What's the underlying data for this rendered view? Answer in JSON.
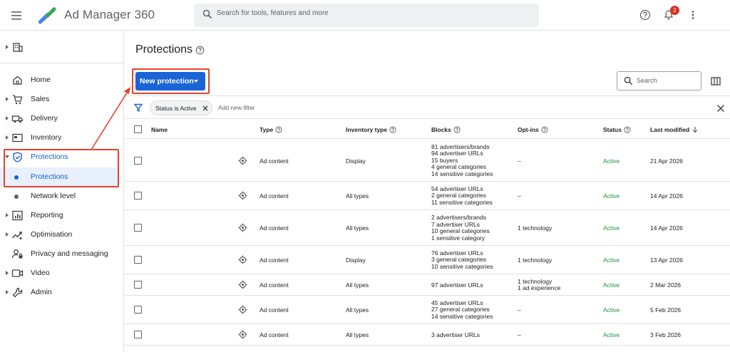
{
  "app": {
    "title": "Ad Manager 360"
  },
  "search": {
    "placeholder": "Search for tools, features and more"
  },
  "notifications": {
    "count": "2"
  },
  "sidebar": {
    "items": [
      {
        "label": "Home",
        "icon": "home-icon"
      },
      {
        "label": "Sales",
        "icon": "cart-icon"
      },
      {
        "label": "Delivery",
        "icon": "truck-icon"
      },
      {
        "label": "Inventory",
        "icon": "inventory-icon"
      },
      {
        "label": "Protections",
        "icon": "shield-icon"
      },
      {
        "label": "Protections",
        "icon": "dot"
      },
      {
        "label": "Network level",
        "icon": "dot"
      },
      {
        "label": "Reporting",
        "icon": "reporting-icon"
      },
      {
        "label": "Optimisation",
        "icon": "optimisation-icon"
      },
      {
        "label": "Privacy and messaging",
        "icon": "privacy-icon"
      },
      {
        "label": "Video",
        "icon": "video-icon"
      },
      {
        "label": "Admin",
        "icon": "wrench-icon"
      }
    ]
  },
  "page": {
    "title": "Protections",
    "new_button_label": "New protection",
    "table_search_placeholder": "Search"
  },
  "filters": {
    "chip_label": "Status is Active",
    "add_filter_label": "Add new filter"
  },
  "table": {
    "columns": [
      "Name",
      "Type",
      "Inventory type",
      "Blocks",
      "Opt-ins",
      "Status",
      "Last modified"
    ],
    "sort_column": "Last modified",
    "sort_direction": "descending",
    "rows": [
      {
        "type": "Ad content",
        "inventory_type": "Display",
        "blocks": "81 advertisers/brands\n94 advertiser URLs\n15 buyers\n4 general categories\n14 sensitive categories",
        "opt_ins": "–",
        "status": "Active",
        "last_modified": "21 Apr 2026"
      },
      {
        "type": "Ad content",
        "inventory_type": "All types",
        "blocks": "54 advertiser URLs\n2 general categories\n11 sensitive categories",
        "opt_ins": "–",
        "status": "Active",
        "last_modified": "14 Apr 2026"
      },
      {
        "type": "Ad content",
        "inventory_type": "All types",
        "blocks": "2 advertisers/brands\n7 advertiser URLs\n10 general categories\n1 sensitive category",
        "opt_ins": "1 technology",
        "status": "Active",
        "last_modified": "14 Apr 2026"
      },
      {
        "type": "Ad content",
        "inventory_type": "Display",
        "blocks": "76 advertiser URLs\n3 general categories\n10 sensitive categories",
        "opt_ins": "1 technology",
        "status": "Active",
        "last_modified": "13 Apr 2026"
      },
      {
        "type": "Ad content",
        "inventory_type": "All types",
        "blocks": "97 advertiser URLs",
        "opt_ins": "1 technology\n1 ad experience",
        "status": "Active",
        "last_modified": "2 Mar 2026"
      },
      {
        "type": "Ad content",
        "inventory_type": "All types",
        "blocks": "45 advertiser URLs\n27 general categories\n14 sensitive categories",
        "opt_ins": "–",
        "status": "Active",
        "last_modified": "5 Feb 2026"
      },
      {
        "type": "Ad content",
        "inventory_type": "All types",
        "blocks": "3 advertiser URLs",
        "opt_ins": "–",
        "status": "Active",
        "last_modified": "3 Feb 2026"
      }
    ]
  },
  "colors": {
    "accent": "#1a64d8",
    "active_status": "#1e8e3e",
    "annotation": "#e8412c",
    "selected_bg": "#e8f0fe"
  }
}
